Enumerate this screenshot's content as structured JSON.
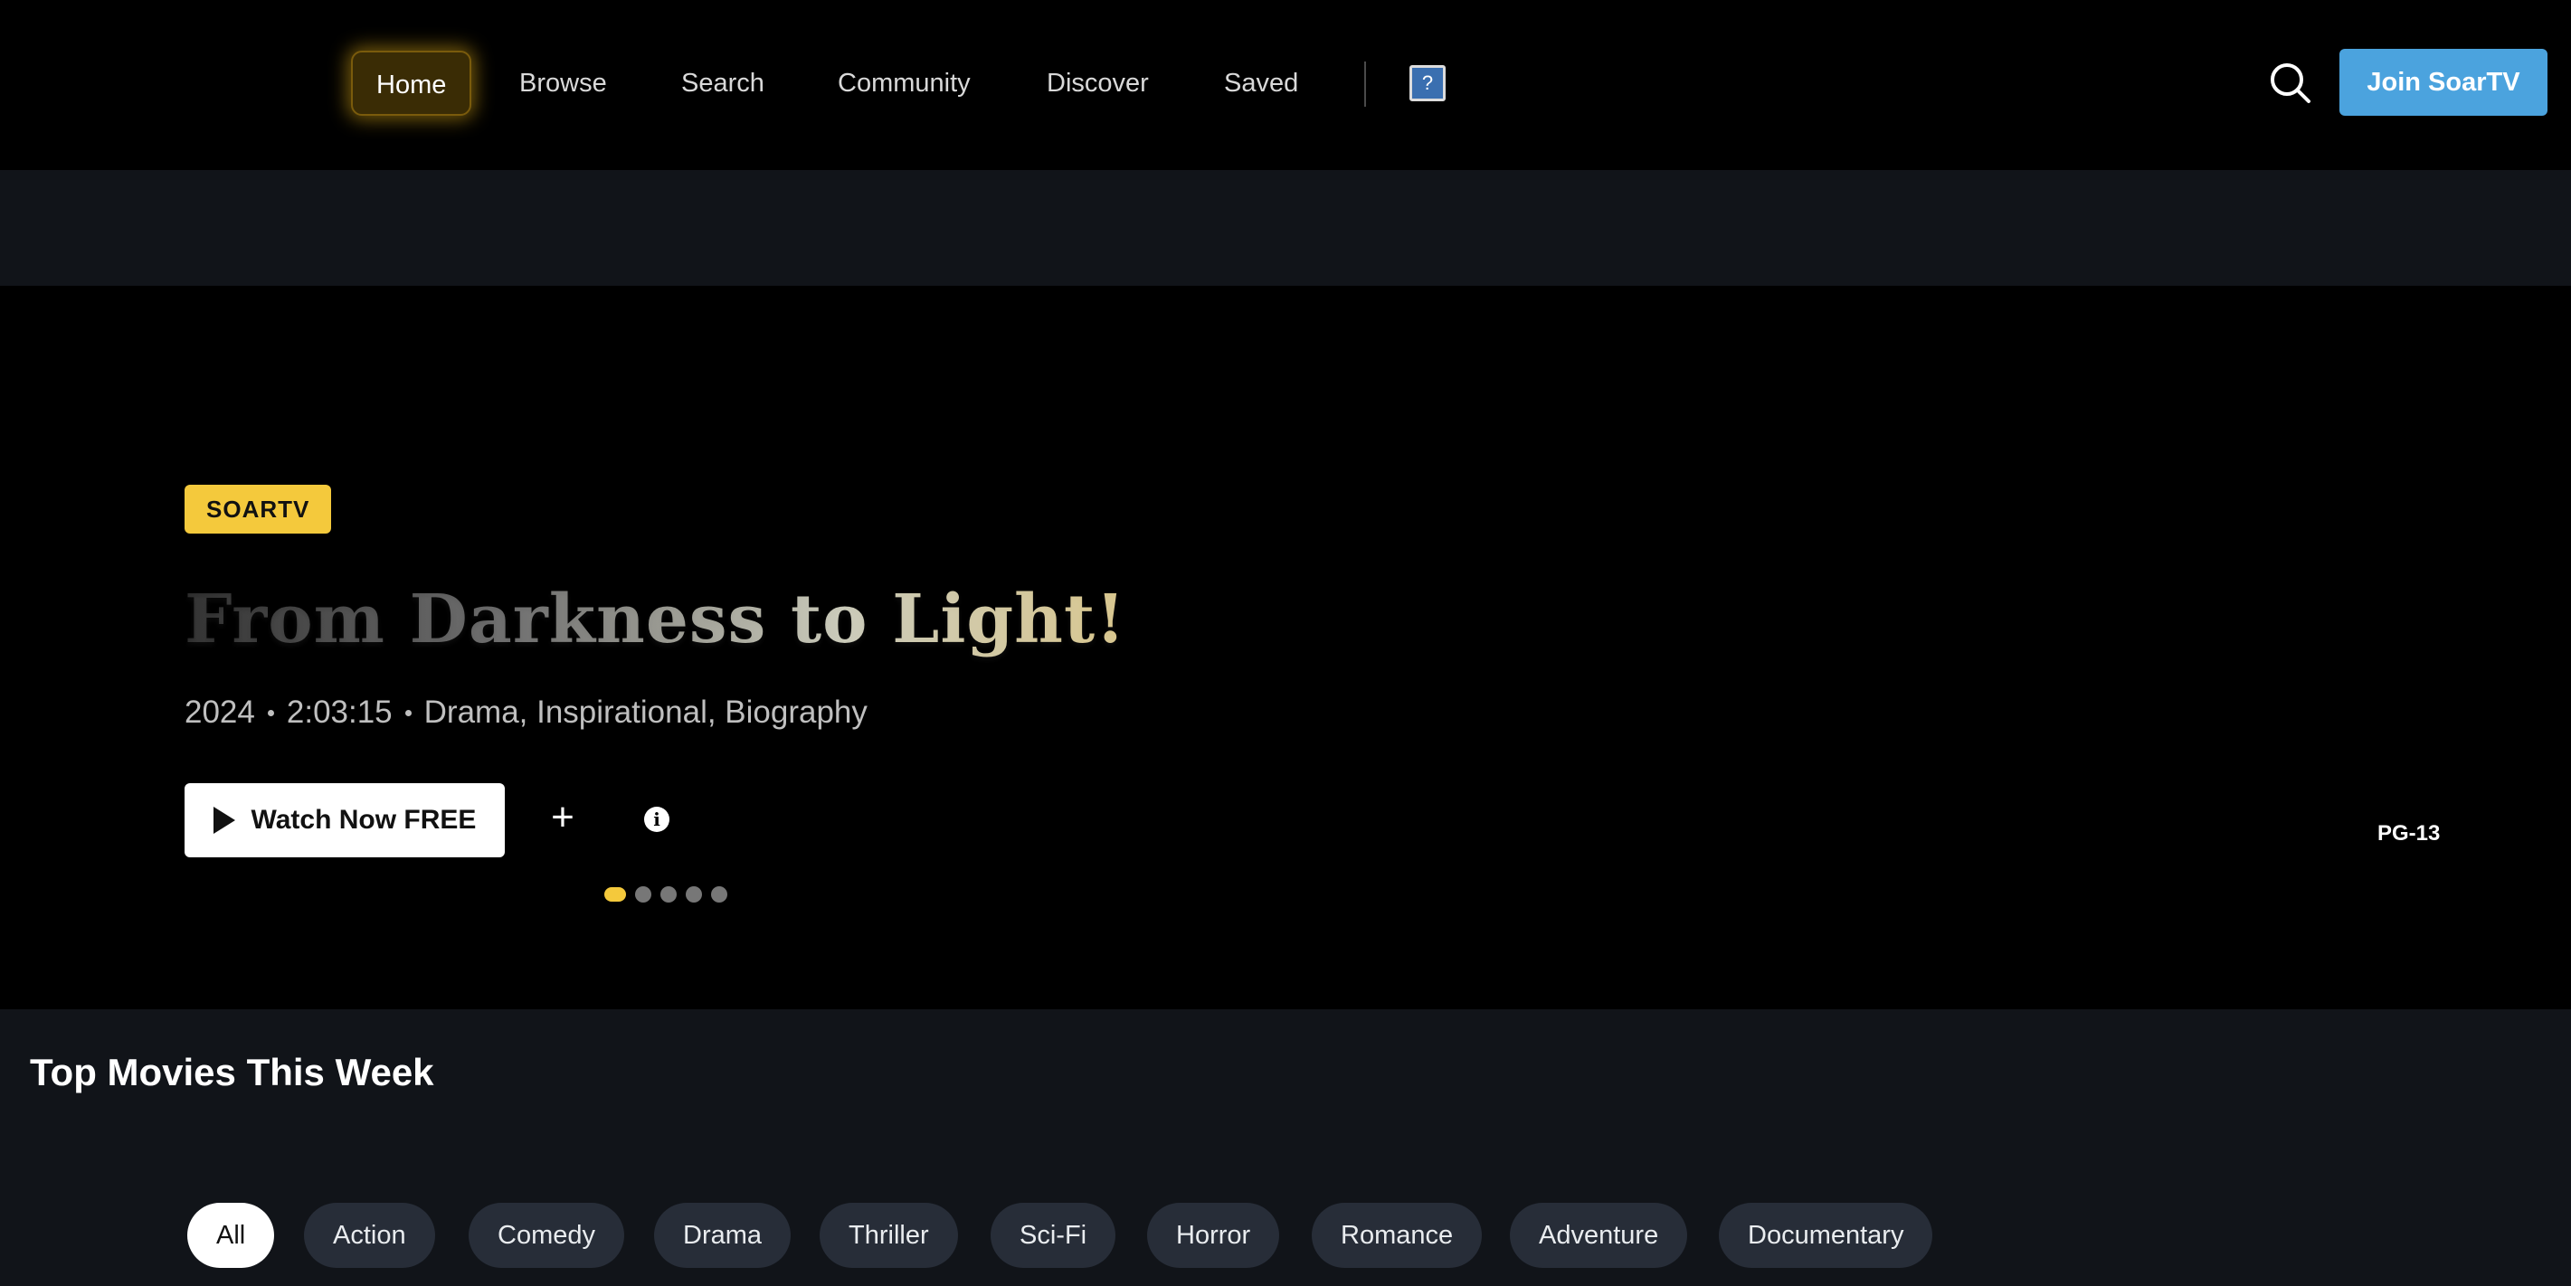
{
  "nav": {
    "items": [
      {
        "label": "Home",
        "active": true
      },
      {
        "label": "Browse",
        "active": false
      },
      {
        "label": "Search",
        "active": false
      },
      {
        "label": "Community",
        "active": false
      },
      {
        "label": "Discover",
        "active": false
      },
      {
        "label": "Saved",
        "active": false
      }
    ],
    "help_glyph": "?",
    "search_icon": "search-icon",
    "join_label": "Join SoarTV"
  },
  "hero": {
    "badge": "SOARTV",
    "title": "From Darkness to Light!",
    "year": "2024",
    "duration": "2:03:15",
    "genres": "Drama, Inspirational, Biography",
    "watch_label": "Watch Now FREE",
    "add_glyph": "+",
    "info_glyph": "i",
    "rating": "PG-13",
    "slide_count": 5,
    "active_slide": 0
  },
  "top_movies": {
    "title": "Top Movies This Week",
    "chips": [
      "All",
      "Action",
      "Comedy",
      "Drama",
      "Thriller",
      "Sci-Fi",
      "Horror",
      "Romance",
      "Adventure",
      "Documentary"
    ],
    "active_chip": "All"
  },
  "colors": {
    "accent_gold": "#f4c93c",
    "join_blue": "#4ba3de",
    "chip_bg": "#272d38",
    "section_bg": "#111419"
  }
}
